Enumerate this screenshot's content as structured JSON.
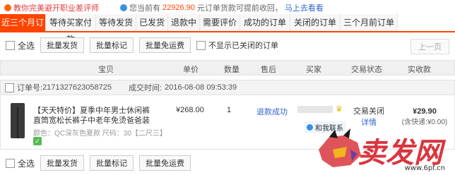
{
  "tips": {
    "left": "教你完美避开职业差评师",
    "right_prefix": "您当前有",
    "right_amount": "22926.90",
    "right_suffix": "元订单货款可提前收回，",
    "right_link": "马上去看看"
  },
  "tabs": [
    "近三个月订单",
    "等待买家付款",
    "等待发货",
    "已发货",
    "退款中",
    "需要评价",
    "成功的订单",
    "关闭的订单",
    "三个月前订单"
  ],
  "batch_top": {
    "select_all": "全选",
    "buttons": [
      "批量发货",
      "批量标记",
      "批量免运费"
    ],
    "hide_closed": "不显示已关闭的订单",
    "prev_page": "上一页"
  },
  "table_headers": [
    "宝贝",
    "单价",
    "数量",
    "售后",
    "买家",
    "交易状态",
    "实收款"
  ],
  "order": {
    "number_label": "订单号:",
    "number": "2171327623058725",
    "time_label": "成交时间:",
    "time": "2016-08-08 09:53:39",
    "product_name": "【天天特价】夏季中年男士休闲裤直筒宽松长裤子中老年免烫爸爸装",
    "product_attr": "颜色：QC深灰色夏款  尺码：30【二尺三】",
    "price": "¥268.00",
    "qty": "1",
    "after_sale": "退款成功",
    "contact": "和我联系",
    "status": "交易关闭",
    "detail": "详情",
    "total": "¥29.90",
    "shipping": "(含快递:¥0.00)"
  },
  "batch_bottom": {
    "select_all": "全选",
    "buttons": [
      "批量发货",
      "批量标记",
      "批量免运费"
    ]
  },
  "watermark": {
    "text": "卖发网",
    "url": "www.6pf.cn"
  },
  "colors": {
    "accent": "#ff4400",
    "link": "#3366cc",
    "watermark": "#d9363e"
  }
}
